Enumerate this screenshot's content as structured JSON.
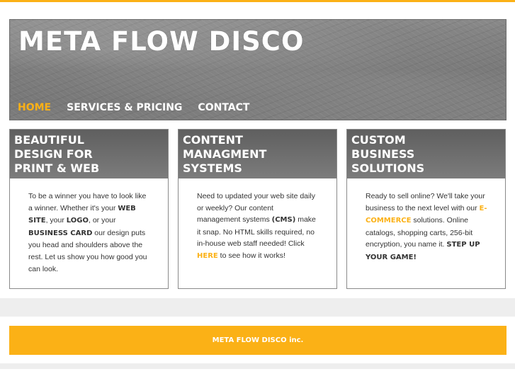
{
  "brand": {
    "title": "META FLOW DISCO",
    "accent": "#fbb116"
  },
  "nav": {
    "items": [
      {
        "label": "HOME",
        "active": true
      },
      {
        "label": "SERVICES & PRICING",
        "active": false
      },
      {
        "label": "CONTACT",
        "active": false
      }
    ]
  },
  "cards": [
    {
      "heading": [
        "BEAUTIFUL",
        "DESIGN FOR",
        "PRINT & WEB"
      ],
      "body": [
        {
          "t": "To be a winner you have to look like a winner. Whether it's your "
        },
        {
          "t": "WEB SITE",
          "b": true
        },
        {
          "t": ", your "
        },
        {
          "t": "LOGO",
          "b": true
        },
        {
          "t": ", or your "
        },
        {
          "t": "BUSINESS CARD",
          "b": true
        },
        {
          "t": " our design puts you head and shoulders above the rest. Let us show you how good you can look."
        }
      ]
    },
    {
      "heading": [
        "CONTENT",
        "MANAGMENT",
        "SYSTEMS"
      ],
      "body": [
        {
          "t": "Need to updated your web site daily or weekly? Our content management systems "
        },
        {
          "t": "(CMS)",
          "b": true
        },
        {
          "t": " make it snap. No HTML skills required, no in-house web staff needed! Click "
        },
        {
          "t": "HERE",
          "b": true,
          "hl": true,
          "link": true
        },
        {
          "t": " to see how it works!"
        }
      ]
    },
    {
      "heading": [
        "CUSTOM",
        "BUSINESS",
        "SOLUTIONS"
      ],
      "body": [
        {
          "t": "Ready to sell online? We'll take your business to the next level with our "
        },
        {
          "t": "E-COMMERCE",
          "b": true,
          "hl": true
        },
        {
          "t": " solutions. Online catalogs, shopping carts, 256-bit encryption, you name it. "
        },
        {
          "t": "STEP UP YOUR GAME!",
          "b": true
        }
      ]
    }
  ],
  "footer": {
    "text": "META FLOW DISCO inc."
  }
}
